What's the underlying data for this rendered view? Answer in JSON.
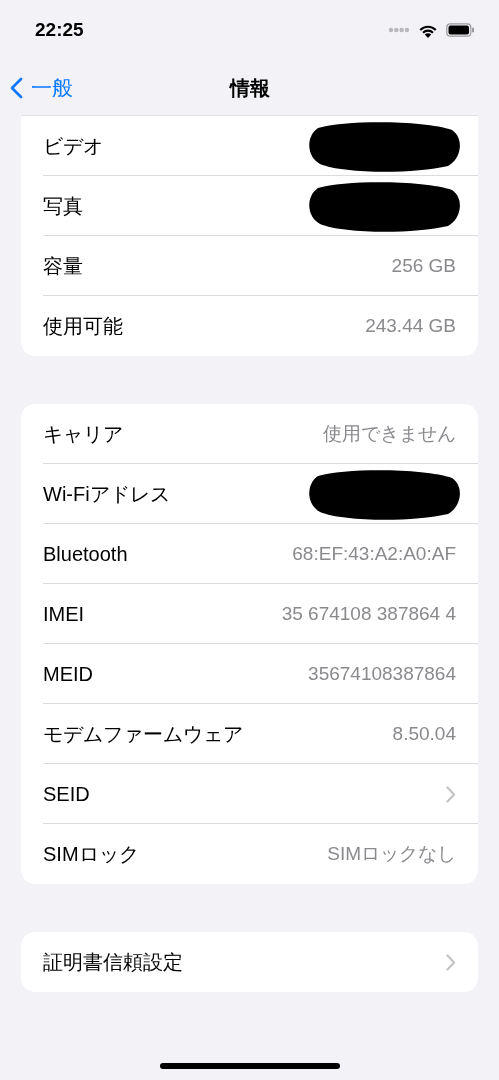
{
  "status_bar": {
    "time": "22:25"
  },
  "nav": {
    "back_label": "一般",
    "title": "情報"
  },
  "sections": [
    {
      "top_cut": true,
      "rows": [
        {
          "label": "ビデオ",
          "redacted": true
        },
        {
          "label": "写真",
          "redacted": true
        },
        {
          "label": "容量",
          "value": "256 GB"
        },
        {
          "label": "使用可能",
          "value": "243.44 GB"
        }
      ]
    },
    {
      "top_cut": false,
      "rows": [
        {
          "label": "キャリア",
          "value": "使用できません"
        },
        {
          "label": "Wi-Fiアドレス",
          "redacted": true
        },
        {
          "label": "Bluetooth",
          "value": "68:EF:43:A2:A0:AF"
        },
        {
          "label": "IMEI",
          "value": "35 674108 387864 4"
        },
        {
          "label": "MEID",
          "value": "35674108387864"
        },
        {
          "label": "モデムファームウェア",
          "value": "8.50.04"
        },
        {
          "label": "SEID",
          "chevron": true
        },
        {
          "label": "SIMロック",
          "value": "SIMロックなし"
        }
      ]
    },
    {
      "top_cut": false,
      "rows": [
        {
          "label": "証明書信頼設定",
          "chevron": true
        }
      ]
    }
  ]
}
